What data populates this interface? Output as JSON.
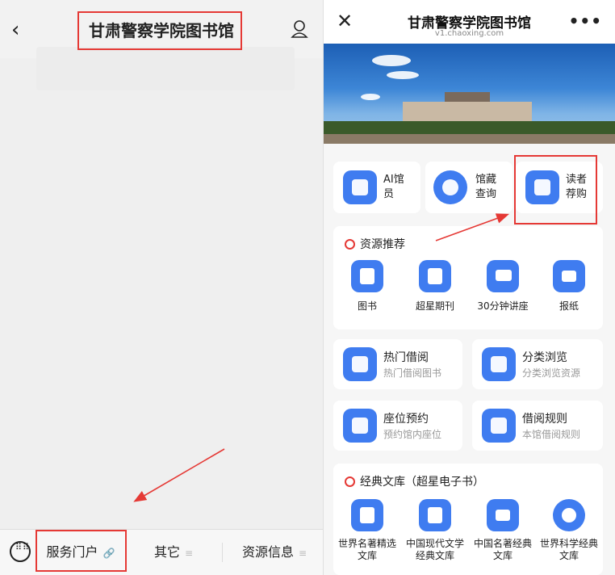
{
  "left": {
    "back_icon": "chevron-left-icon",
    "title": "甘肃警察学院图书馆",
    "user_icon": "user-icon",
    "keyboard_icon": "keyboard-icon",
    "tabs": [
      {
        "label": "服务门户",
        "suffix": "🔗"
      },
      {
        "label": "其它",
        "suffix": "≡"
      },
      {
        "label": "资源信息",
        "suffix": "≡"
      }
    ]
  },
  "right": {
    "close_icon": "close-icon",
    "title": "甘肃警察学院图书馆",
    "subtitle": "v1.chaoxing.com",
    "more_icon": "more-icon",
    "quick": [
      {
        "label1": "AI馆",
        "label2": "员",
        "icon": "robot-icon"
      },
      {
        "label1": "馆藏",
        "label2": "查询",
        "icon": "search-icon"
      },
      {
        "label1": "读者",
        "label2": "荐购",
        "icon": "recommend-icon"
      }
    ],
    "resources": {
      "title": "资源推荐",
      "items": [
        {
          "label": "图书",
          "icon": "book-icon"
        },
        {
          "label": "超星期刊",
          "icon": "journal-icon"
        },
        {
          "label": "30分钟讲座",
          "icon": "lecture-icon"
        },
        {
          "label": "报纸",
          "icon": "newspaper-icon"
        }
      ]
    },
    "services": [
      {
        "title": "热门借阅",
        "sub": "热门借阅图书",
        "icon": "hot-book-icon"
      },
      {
        "title": "分类浏览",
        "sub": "分类浏览资源",
        "icon": "category-icon"
      },
      {
        "title": "座位预约",
        "sub": "预约馆内座位",
        "icon": "seat-icon"
      },
      {
        "title": "借阅规则",
        "sub": "本馆借阅规则",
        "icon": "rules-icon"
      }
    ],
    "classics": {
      "title": "经典文库（超星电子书）",
      "items": [
        {
          "label1": "世界名著精选",
          "label2": "文库",
          "icon": "world-classics-icon"
        },
        {
          "label1": "中国现代文学",
          "label2": "经典文库",
          "icon": "cn-modern-icon"
        },
        {
          "label1": "中国名著经典",
          "label2": "文库",
          "icon": "cn-classics-icon"
        },
        {
          "label1": "世界科学经典",
          "label2": "文库",
          "icon": "globe-icon"
        }
      ]
    }
  }
}
